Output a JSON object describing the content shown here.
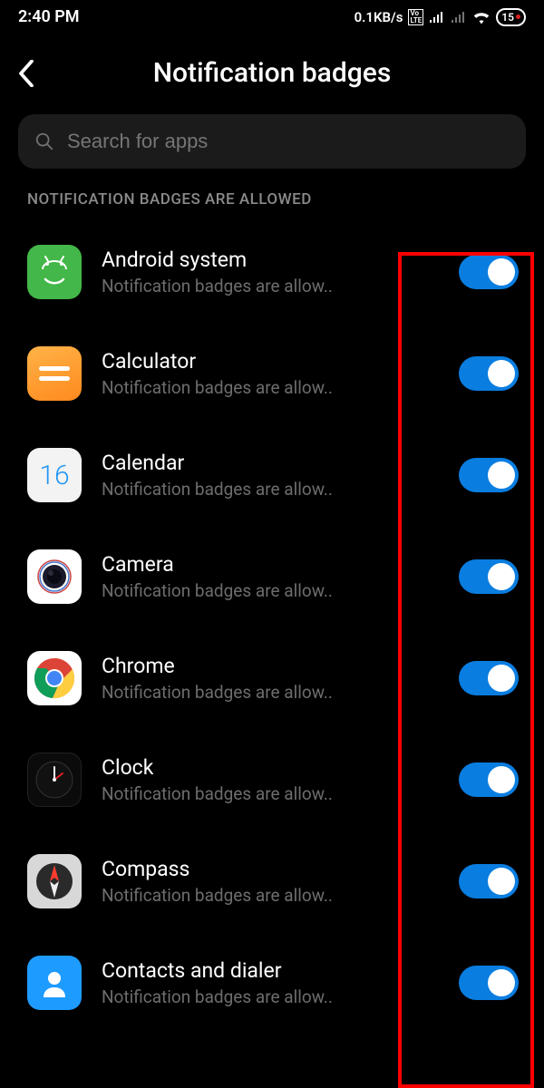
{
  "status": {
    "time": "2:40 PM",
    "net_speed": "0.1KB/s",
    "volte": "Vo LTE",
    "battery": "15"
  },
  "header": {
    "title": "Notification badges"
  },
  "search": {
    "placeholder": "Search for apps"
  },
  "section_label": "NOTIFICATION BADGES ARE ALLOWED",
  "apps": [
    {
      "name": "Android system",
      "sub": "Notification badges are allow..",
      "enabled": true,
      "icon": "android"
    },
    {
      "name": "Calculator",
      "sub": "Notification badges are allow..",
      "enabled": true,
      "icon": "calculator"
    },
    {
      "name": "Calendar",
      "sub": "Notification badges are allow..",
      "enabled": true,
      "icon": "calendar",
      "date": "16"
    },
    {
      "name": "Camera",
      "sub": "Notification badges are allow..",
      "enabled": true,
      "icon": "camera"
    },
    {
      "name": "Chrome",
      "sub": "Notification badges are allow..",
      "enabled": true,
      "icon": "chrome"
    },
    {
      "name": "Clock",
      "sub": "Notification badges are allow..",
      "enabled": true,
      "icon": "clock"
    },
    {
      "name": "Compass",
      "sub": "Notification badges are allow..",
      "enabled": true,
      "icon": "compass"
    },
    {
      "name": "Contacts and dialer",
      "sub": "Notification badges are allow..",
      "enabled": true,
      "icon": "contacts"
    }
  ]
}
